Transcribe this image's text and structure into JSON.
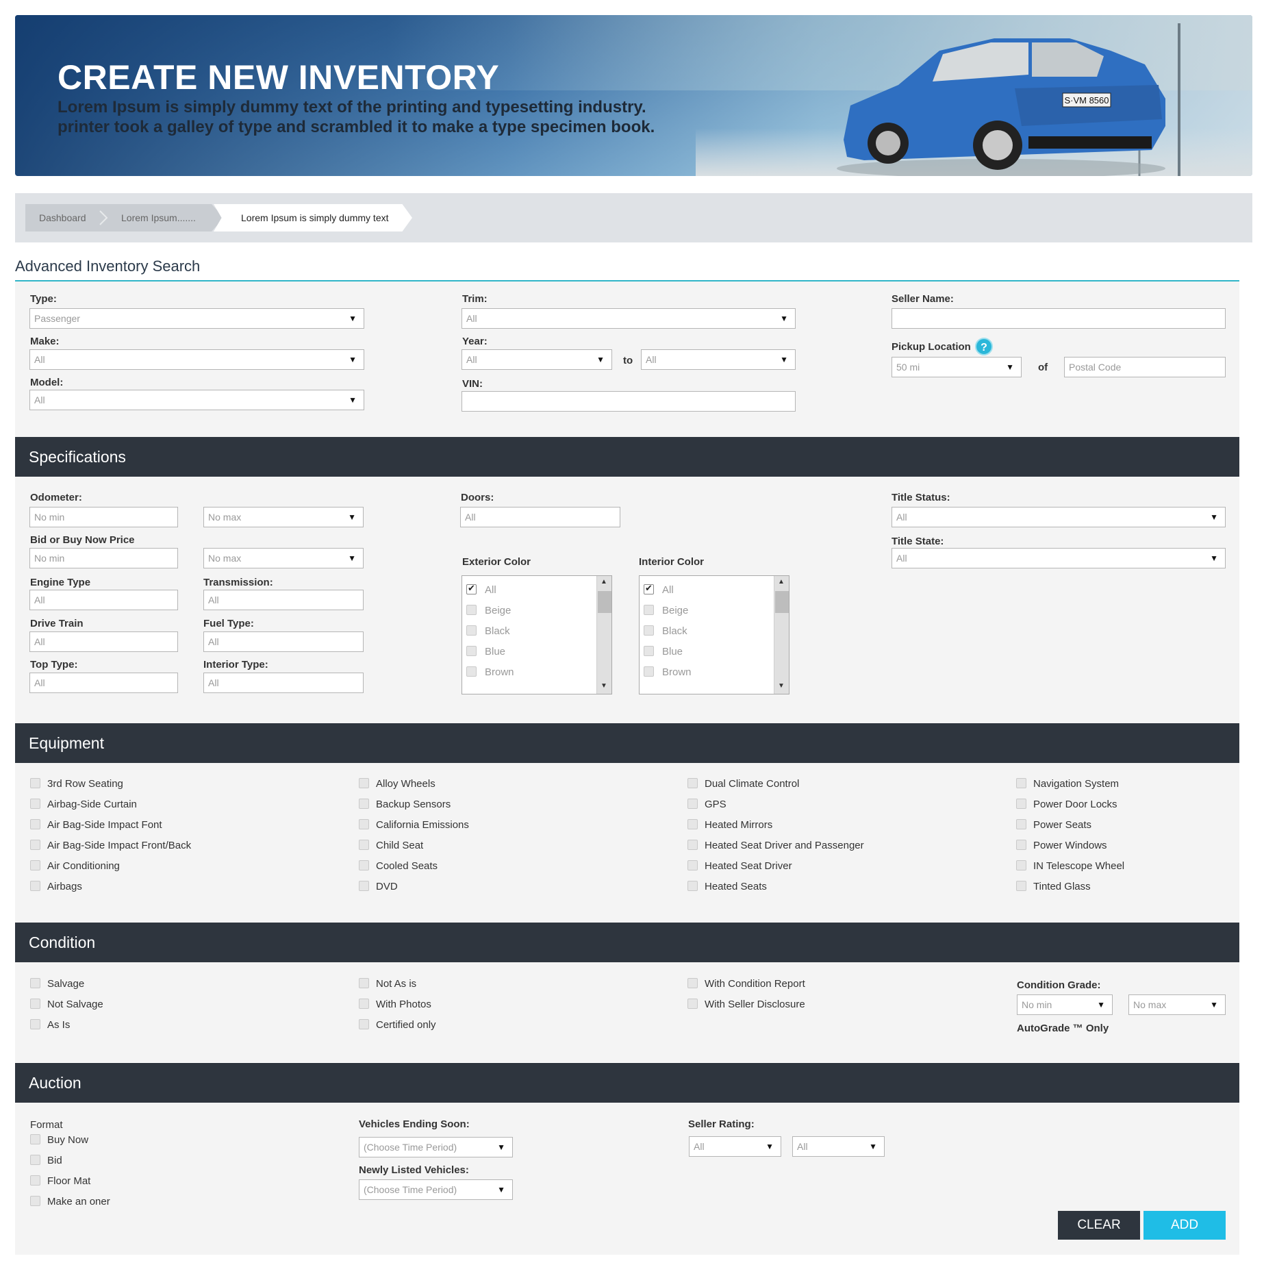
{
  "hero": {
    "title": "CREATE NEW INVENTORY",
    "subtitle_line1": "Lorem Ipsum is simply dummy text of the printing and typesetting industry.",
    "subtitle_line2": "printer took a galley of type and scrambled it to make a type specimen book.",
    "plate": "S·VM 8560"
  },
  "breadcrumb": [
    "Dashboard",
    "Lorem Ipsum.......",
    "Lorem Ipsum is simply dummy text"
  ],
  "search": {
    "title": "Advanced Inventory Search",
    "type_label": "Type:",
    "type_value": "Passenger",
    "make_label": "Make:",
    "make_value": "All",
    "model_label": "Model:",
    "model_value": "All",
    "trim_label": "Trim:",
    "trim_value": "All",
    "year_label": "Year:",
    "year_from": "All",
    "year_to_label": "to",
    "year_to": "All",
    "vin_label": "VIN:",
    "vin_value": "",
    "seller_label": "Seller Name:",
    "seller_value": "",
    "pickup_label": "Pickup Location",
    "help_icon": "?",
    "pickup_distance": "50 mi",
    "of_label": "of",
    "postal_placeholder": "Postal Code"
  },
  "specifications": {
    "title": "Specifications",
    "odometer_label": "Odometer:",
    "odometer_min": "No min",
    "odometer_max": "No max",
    "price_label": "Bid or Buy Now Price",
    "price_min": "No min",
    "price_max": "No max",
    "engine_label": "Engine Type",
    "engine_value": "All",
    "transmission_label": "Transmission:",
    "transmission_value": "All",
    "drive_label": "Drive Train",
    "drive_value": "All",
    "fuel_label": "Fuel Type:",
    "fuel_value": "All",
    "top_label": "Top Type:",
    "top_value": "All",
    "interior_type_label": "Interior Type:",
    "interior_type_value": "All",
    "doors_label": "Doors:",
    "doors_value": "All",
    "exterior_color_label": "Exterior Color",
    "interior_color_label": "Interior Color",
    "colors": [
      "All",
      "Beige",
      "Black",
      "Blue",
      "Brown"
    ],
    "title_status_label": "Title Status:",
    "title_status_value": "All",
    "title_state_label": "Title State:",
    "title_state_value": "All"
  },
  "equipment": {
    "title": "Equipment",
    "columns": [
      [
        "3rd Row Seating",
        "Airbag-Side Curtain",
        "Air Bag-Side Impact Font",
        "Air Bag-Side Impact Front/Back",
        "Air Conditioning",
        "Airbags"
      ],
      [
        "Alloy Wheels",
        "Backup Sensors",
        "California Emissions",
        "Child Seat",
        "Cooled Seats",
        "DVD"
      ],
      [
        "Dual Climate Control",
        "GPS",
        "Heated Mirrors",
        "Heated Seat Driver and Passenger",
        "Heated Seat Driver",
        "Heated Seats"
      ],
      [
        "Navigation System",
        "Power Door Locks",
        "Power Seats",
        "Power Windows",
        "IN Telescope Wheel",
        "Tinted Glass"
      ]
    ]
  },
  "condition": {
    "title": "Condition",
    "columns": [
      [
        "Salvage",
        "Not Salvage",
        "As Is"
      ],
      [
        "Not As is",
        "With Photos",
        "Certified only"
      ],
      [
        "With Condition Report",
        "With Seller Disclosure"
      ]
    ],
    "grade_label": "Condition Grade:",
    "grade_min": "No min",
    "grade_max": "No max",
    "autograde": "AutoGrade ™ Only"
  },
  "auction": {
    "title": "Auction",
    "format_label": "Format",
    "formats": [
      "Buy Now",
      "Bid",
      "Floor Mat",
      "Make an oner"
    ],
    "ending_label": "Vehicles Ending Soon:",
    "ending_value": "(Choose Time Period)",
    "newly_label": "Newly Listed Vehicles:",
    "newly_value": "(Choose Time Period)",
    "rating_label": "Seller Rating:",
    "rating_from": "All",
    "rating_to": "All"
  },
  "buttons": {
    "clear": "CLEAR",
    "add": "ADD"
  }
}
